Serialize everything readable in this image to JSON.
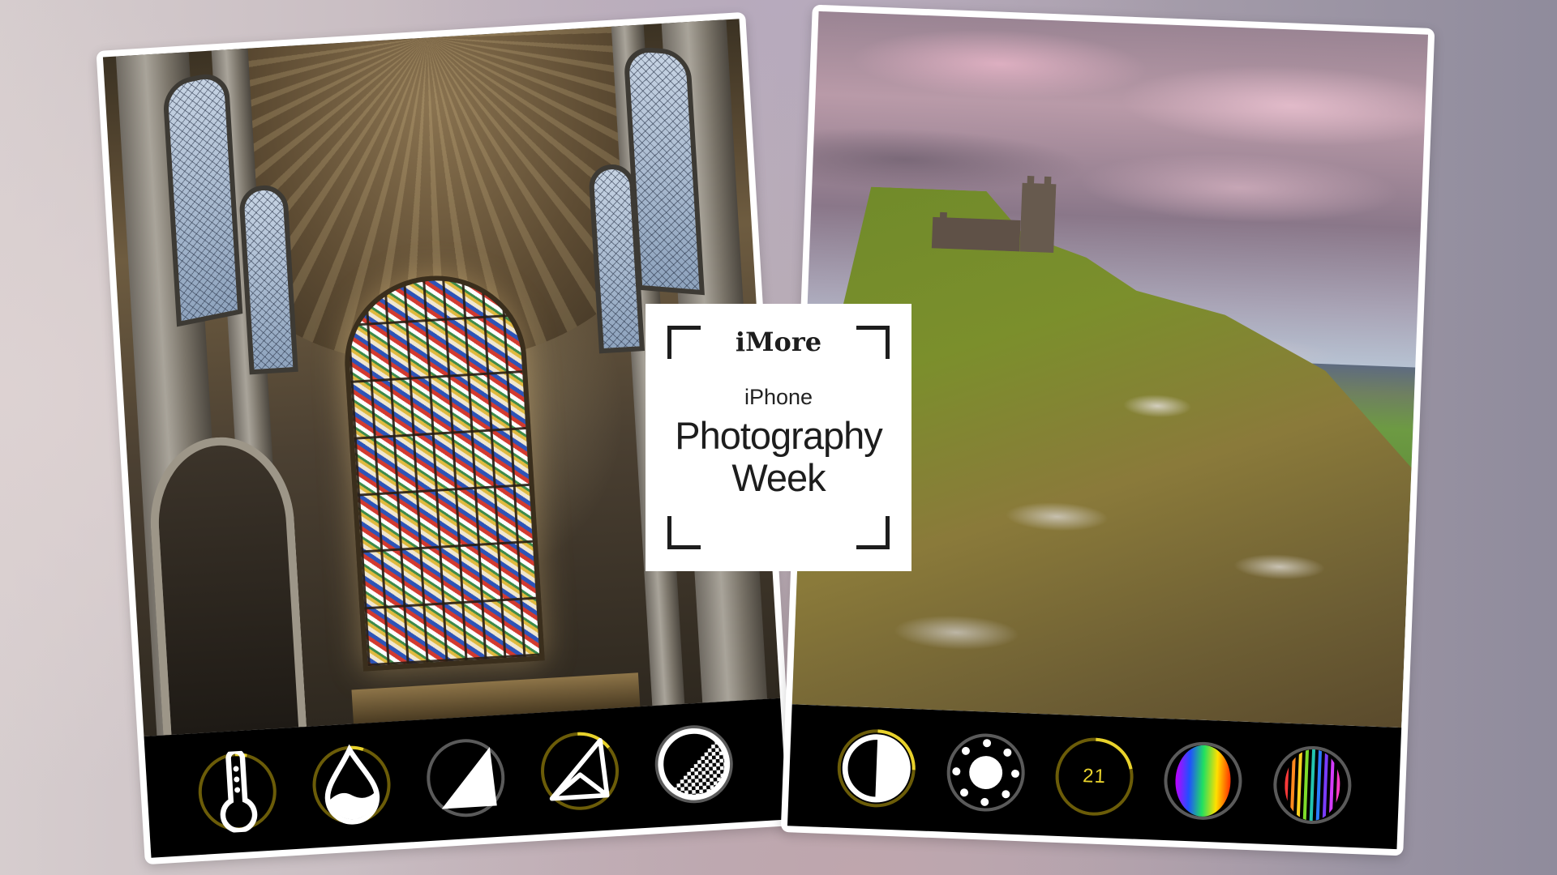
{
  "badge": {
    "brand": "iMore",
    "subtitle": "iPhone",
    "title_line1": "Photography",
    "title_line2": "Week"
  },
  "colors": {
    "accent_yellow": "#e8d22c",
    "dial_active_ring": "#6b5c08",
    "dial_inactive_ring": "#5a5a5a",
    "toolbar_bg": "#000000",
    "card_border": "#ffffff"
  },
  "left_card": {
    "photo_subject": "cathedral interior with stained glass window",
    "dials": [
      {
        "icon": "thermometer-icon",
        "name": "temperature",
        "active": true,
        "level": 0.05
      },
      {
        "icon": "droplet-icon",
        "name": "tint",
        "active": true,
        "level": 0.06
      },
      {
        "icon": "highlights-triangle-icon",
        "name": "highlights",
        "active": false,
        "level": 0
      },
      {
        "icon": "shadows-triangle-icon",
        "name": "shadows",
        "active": true,
        "level": 0.15
      },
      {
        "icon": "contrast-hatched-circle-icon",
        "name": "tone",
        "active": false,
        "level": 0
      }
    ]
  },
  "right_card": {
    "photo_subject": "hilltop church tower over green moorland at sunset",
    "dials": [
      {
        "icon": "contrast-icon",
        "name": "contrast",
        "active": true,
        "level": 0.25
      },
      {
        "icon": "sun-icon",
        "name": "brightness",
        "active": false,
        "level": 0
      },
      {
        "icon": "",
        "name": "value",
        "active": true,
        "level": 0.21,
        "value_text": "21"
      },
      {
        "icon": "saturation-spectrum-icon",
        "name": "saturation",
        "active": false,
        "level": 0
      },
      {
        "icon": "vibrance-stripes-icon",
        "name": "vibrance",
        "active": false,
        "level": 0
      }
    ]
  }
}
